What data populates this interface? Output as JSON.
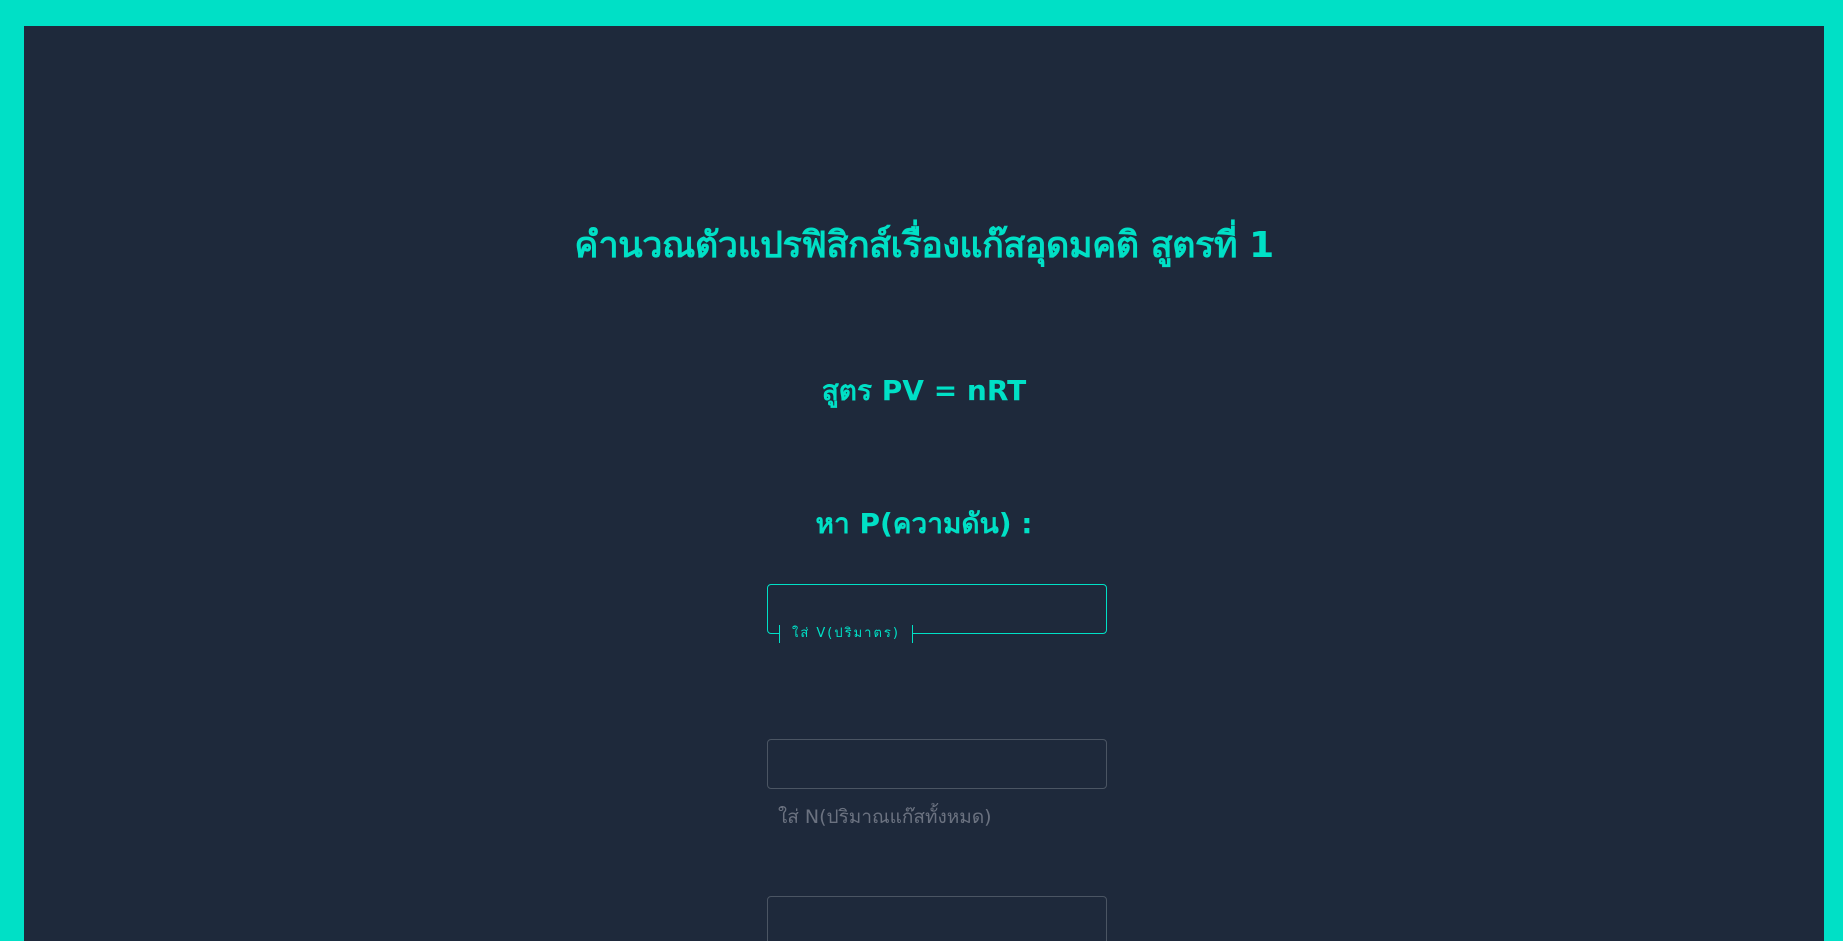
{
  "page": {
    "title": "คำนวณตัวแปรฟิสิกส์เรื่องแก๊สอุดมคติ สูตรที่ 1",
    "formula": "สูตร PV = nRT",
    "find_label": "หา P(ความดัน) :"
  },
  "fields": [
    {
      "label": "ใส่ V(ปริมาตร)",
      "value": "",
      "state": "focused"
    },
    {
      "label": "ใส่ N(ปริมาณแก๊สทั้งหมด)",
      "value": "",
      "state": "idle"
    },
    {
      "label": "",
      "value": "",
      "state": "idle"
    }
  ],
  "colors": {
    "accent": "#00e0c6",
    "background": "#1e293b",
    "frame": "#00e0c6",
    "muted_text": "#6b7280",
    "idle_border": "#4b5563"
  }
}
